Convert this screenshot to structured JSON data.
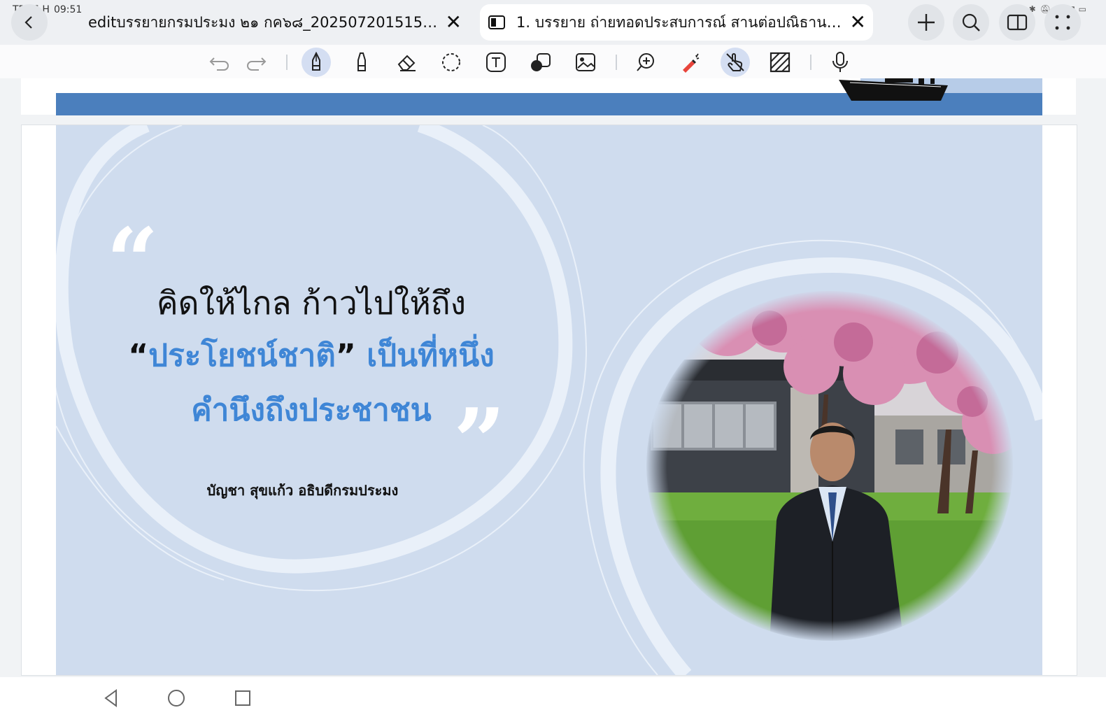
{
  "status_bar": {
    "carrier": "TRUE-H",
    "time": "09:51"
  },
  "tabs": [
    {
      "title": "editบรรยายกรมประมง ๒๑ กค๖๘_202507201515_0...",
      "active": false
    },
    {
      "title": "1. บรรยาย ถ่ายทอดประสบการณ์ สานต่อปณิธาน ...",
      "active": true
    }
  ],
  "toolbar": {
    "tools": [
      "undo-icon",
      "redo-icon",
      "pen-icon",
      "highlighter-icon",
      "eraser-icon",
      "lasso-icon",
      "text-icon",
      "shapes-icon",
      "image-icon",
      "zoom-icon",
      "laser-pointer-icon",
      "touch-draw-icon",
      "pattern-icon",
      "microphone-icon"
    ],
    "selected": [
      "pen-icon",
      "touch-draw-icon"
    ]
  },
  "slide": {
    "quote_line1": "คิดให้ไกล ก้าวไปให้ถึง",
    "quote_line2_open": "“",
    "quote_line2_main": "ประโยชน์ชาติ",
    "quote_line2_close": "”",
    "quote_line2_rest": " เป็นที่หนึ่ง",
    "quote_line3": "คำนึงถึงประชาชน",
    "attribution": "บัญชา  สุขแก้ว อธิบดีกรมประมง",
    "open_quote_mark": "“",
    "close_quote_mark": "”"
  },
  "colors": {
    "slide_bg": "#cfdcee",
    "accent_blue": "#3f86d6",
    "band_blue": "#4b7fbd"
  }
}
